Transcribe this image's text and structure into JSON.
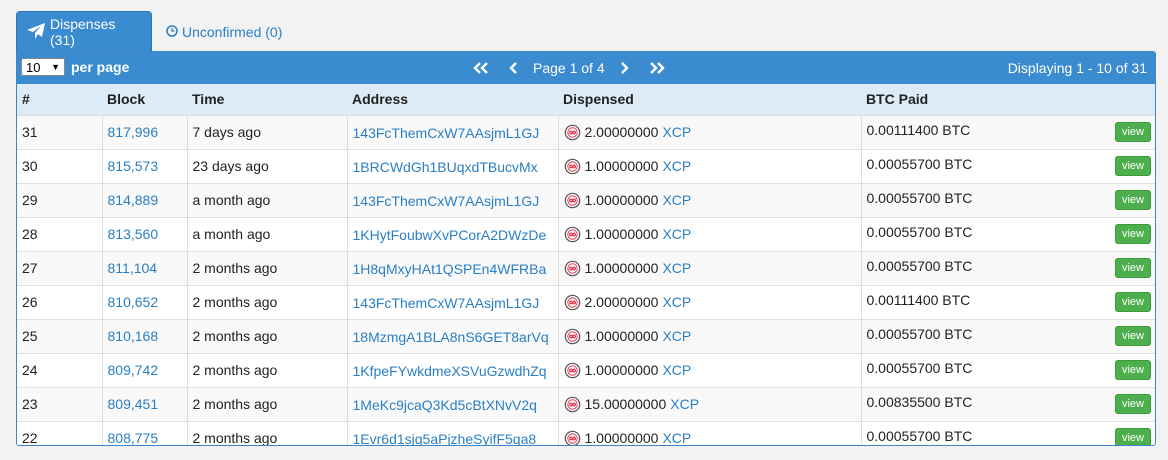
{
  "tabs": [
    {
      "label": "Dispenses (31)",
      "icon": "paper-plane-icon"
    },
    {
      "label": "Unconfirmed (0)",
      "icon": "clock-icon"
    }
  ],
  "toolbar": {
    "per_page_value": "10",
    "per_page_label": "per page",
    "page_text": "Page 1 of 4",
    "displaying": "Displaying 1 - 10 of 31"
  },
  "columns": [
    "#",
    "Block",
    "Time",
    "Address",
    "Dispensed",
    "BTC Paid"
  ],
  "rows": [
    {
      "num": "31",
      "block": "817,996",
      "time": "7 days ago",
      "address": "143FcThemCxW7AAsjmL1GJ",
      "amount": "2.00000000",
      "asset": "XCP",
      "btc": "0.00111400 BTC",
      "action": "view"
    },
    {
      "num": "30",
      "block": "815,573",
      "time": "23 days ago",
      "address": "1BRCWdGh1BUqxdTBucvMx",
      "amount": "1.00000000",
      "asset": "XCP",
      "btc": "0.00055700 BTC",
      "action": "view"
    },
    {
      "num": "29",
      "block": "814,889",
      "time": "a month ago",
      "address": "143FcThemCxW7AAsjmL1GJ",
      "amount": "1.00000000",
      "asset": "XCP",
      "btc": "0.00055700 BTC",
      "action": "view"
    },
    {
      "num": "28",
      "block": "813,560",
      "time": "a month ago",
      "address": "1KHytFoubwXvPCorA2DWzDe",
      "amount": "1.00000000",
      "asset": "XCP",
      "btc": "0.00055700 BTC",
      "action": "view"
    },
    {
      "num": "27",
      "block": "811,104",
      "time": "2 months ago",
      "address": "1H8qMxyHAt1QSPEn4WFRBa",
      "amount": "1.00000000",
      "asset": "XCP",
      "btc": "0.00055700 BTC",
      "action": "view"
    },
    {
      "num": "26",
      "block": "810,652",
      "time": "2 months ago",
      "address": "143FcThemCxW7AAsjmL1GJ",
      "amount": "2.00000000",
      "asset": "XCP",
      "btc": "0.00111400 BTC",
      "action": "view"
    },
    {
      "num": "25",
      "block": "810,168",
      "time": "2 months ago",
      "address": "18MzmgA1BLA8nS6GET8arVq",
      "amount": "1.00000000",
      "asset": "XCP",
      "btc": "0.00055700 BTC",
      "action": "view"
    },
    {
      "num": "24",
      "block": "809,742",
      "time": "2 months ago",
      "address": "1KfpeFYwkdmeXSVuGzwdhZq",
      "amount": "1.00000000",
      "asset": "XCP",
      "btc": "0.00055700 BTC",
      "action": "view"
    },
    {
      "num": "23",
      "block": "809,451",
      "time": "2 months ago",
      "address": "1MeKc9jcaQ3Kd5cBtXNvV2q",
      "amount": "15.00000000",
      "asset": "XCP",
      "btc": "0.00835500 BTC",
      "action": "view"
    },
    {
      "num": "22",
      "block": "808,775",
      "time": "2 months ago",
      "address": "1Evr6d1sjq5aPjzheSyifF5qa8",
      "amount": "1.00000000",
      "asset": "XCP",
      "btc": "0.00055700 BTC",
      "action": "view"
    }
  ],
  "colors": {
    "accent": "#3b8bd0",
    "link": "#2a7fc4",
    "header_row": "#dcebf6",
    "view_button": "#4cae4c",
    "asset_icon": "#e8324a"
  }
}
